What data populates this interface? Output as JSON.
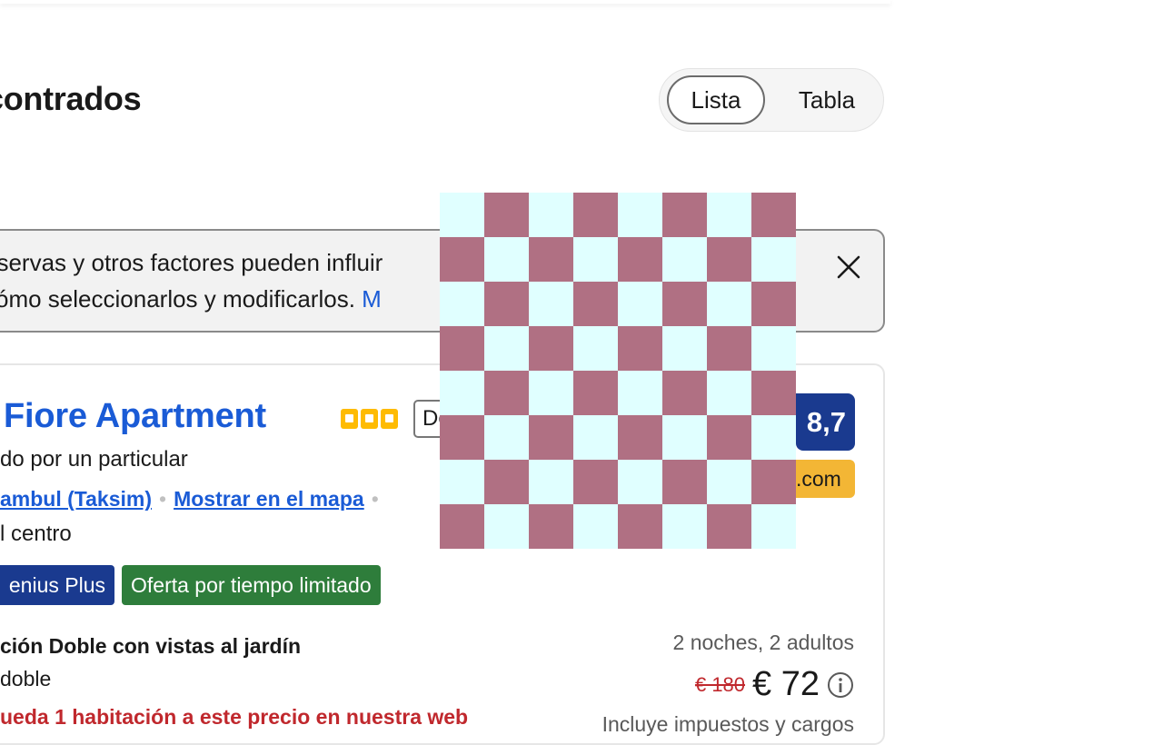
{
  "results_header": {
    "title": "contrados"
  },
  "view_toggle": {
    "options": [
      "Lista",
      "Tabla"
    ],
    "selected": "Lista"
  },
  "notice": {
    "line1": "eservas y otros factores pueden influir",
    "line2": " cómo seleccionarlos y modificarlos.",
    "more_link": "M"
  },
  "property": {
    "name": "m Fiore Apartment",
    "star_rating": 3,
    "badge_text": "De",
    "host": "do por un particular",
    "location": "ambul (Taksim)",
    "map_link": "Mostrar en el mapa",
    "distance": "l centro",
    "tags": [
      "enius Plus",
      "Oferta por tiempo limitado"
    ],
    "room_type": "ción Doble con vistas al jardín",
    "bed": "doble",
    "warning": "ueda 1 habitación a este precio en nuestra web",
    "review_score": "8,7",
    "partner": ".com",
    "stay": "2 noches, 2 adultos",
    "old_price": "€ 180",
    "price": "€ 72",
    "taxes": "Incluye impuestos y cargos"
  },
  "overlay": {
    "colors": {
      "dark": "#b07083",
      "light": "#e0ffff"
    },
    "grid_cells": 8
  },
  "colors": {
    "link": "#1a5bd6",
    "genius": "#1a3a8f",
    "offer": "#2e7d3b",
    "alert": "#c0282d",
    "score": "#1a3a8f"
  }
}
